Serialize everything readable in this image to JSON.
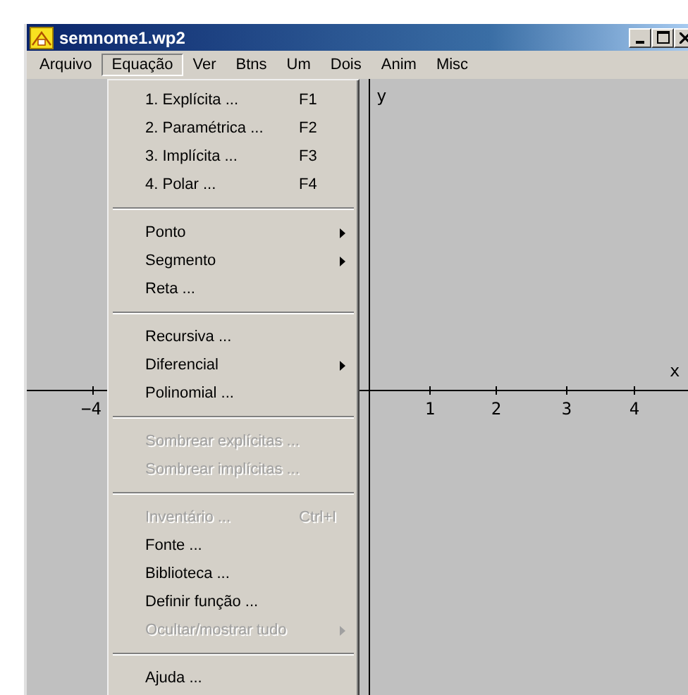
{
  "window": {
    "title": "semnome1.wp2"
  },
  "menubar": [
    {
      "label": "Arquivo",
      "selected": false
    },
    {
      "label": "Equação",
      "selected": true
    },
    {
      "label": "Ver",
      "selected": false
    },
    {
      "label": "Btns",
      "selected": false
    },
    {
      "label": "Um",
      "selected": false
    },
    {
      "label": "Dois",
      "selected": false
    },
    {
      "label": "Anim",
      "selected": false
    },
    {
      "label": "Misc",
      "selected": false
    }
  ],
  "menu": [
    {
      "kind": "item",
      "label": "1. Explícita ...",
      "shortcut": "F1",
      "disabled": false,
      "submenu": false
    },
    {
      "kind": "item",
      "label": "2. Paramétrica ...",
      "shortcut": "F2",
      "disabled": false,
      "submenu": false
    },
    {
      "kind": "item",
      "label": "3. Implícita ...",
      "shortcut": "F3",
      "disabled": false,
      "submenu": false
    },
    {
      "kind": "item",
      "label": "4. Polar ...",
      "shortcut": "F4",
      "disabled": false,
      "submenu": false
    },
    {
      "kind": "separator"
    },
    {
      "kind": "item",
      "label": "Ponto",
      "disabled": false,
      "submenu": true
    },
    {
      "kind": "item",
      "label": "Segmento",
      "disabled": false,
      "submenu": true
    },
    {
      "kind": "item",
      "label": "Reta ...",
      "disabled": false,
      "submenu": false
    },
    {
      "kind": "separator"
    },
    {
      "kind": "item",
      "label": "Recursiva ...",
      "disabled": false,
      "submenu": false
    },
    {
      "kind": "item",
      "label": "Diferencial",
      "disabled": false,
      "submenu": true
    },
    {
      "kind": "item",
      "label": "Polinomial ...",
      "disabled": false,
      "submenu": false
    },
    {
      "kind": "separator"
    },
    {
      "kind": "item",
      "label": "Sombrear explícitas ...",
      "disabled": true,
      "submenu": false
    },
    {
      "kind": "item",
      "label": "Sombrear implícitas ...",
      "disabled": true,
      "submenu": false
    },
    {
      "kind": "separator"
    },
    {
      "kind": "item",
      "label": "Inventário ...",
      "shortcut": "Ctrl+I",
      "disabled": true,
      "submenu": false
    },
    {
      "kind": "item",
      "label": "Fonte ...",
      "disabled": false,
      "submenu": false
    },
    {
      "kind": "item",
      "label": "Biblioteca ...",
      "disabled": false,
      "submenu": false
    },
    {
      "kind": "item",
      "label": "Definir função ...",
      "disabled": false,
      "submenu": false
    },
    {
      "kind": "item",
      "label": "Ocultar/mostrar tudo",
      "disabled": true,
      "submenu": true
    },
    {
      "kind": "separator"
    },
    {
      "kind": "item",
      "label": "Ajuda ...",
      "disabled": false,
      "submenu": false
    }
  ],
  "graph": {
    "x_axis_label": "x",
    "y_axis_label": "y",
    "x_tick_labels": [
      "−4",
      "1",
      "2",
      "3",
      "4"
    ]
  }
}
